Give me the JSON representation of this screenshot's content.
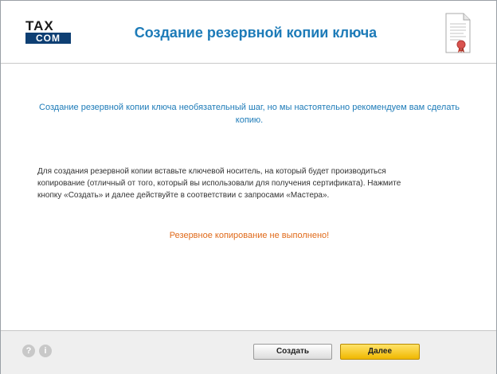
{
  "header": {
    "logo_top": "TAX",
    "logo_bottom": "COM",
    "title": "Создание резервной копии ключа",
    "icon": "certificate-icon"
  },
  "main": {
    "lead": "Создание резервной копии ключа необязательный шаг, но мы настоятельно рекомендуем вам сделать копию.",
    "body_line1": "Для создания резервной копии вставьте ключевой носитель, на который будет производиться",
    "body_line2": "копирование (отличный от того, который вы использовали для получения сертификата). Нажмите",
    "body_line3": "кнопку «Создать» и далее действуйте в соответствии с запросами «Мастера».",
    "warning": "Резервное копирование не выполнено!",
    "warning_color": "#e06a1a",
    "accent_color": "#1d7bb8"
  },
  "footer": {
    "help_icon": "?",
    "info_icon": "i",
    "create_label": "Создать",
    "next_label": "Далее",
    "next_color": "#f0b800"
  }
}
